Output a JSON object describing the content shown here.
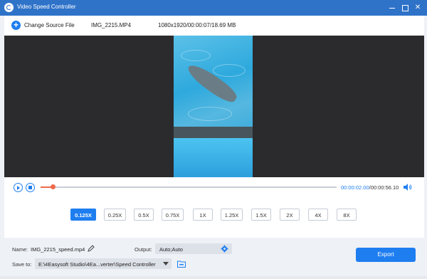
{
  "window": {
    "title": "Video Speed Controller"
  },
  "topbar": {
    "change_source_label": "Change Source File",
    "filename": "IMG_2215.MP4",
    "fileinfo": "1080x1920/00:00:07/18.69 MB"
  },
  "player": {
    "current_time": "00:00:02.00",
    "separator": "/",
    "total_time": "00:00:56.10",
    "progress": 0.04
  },
  "speeds": [
    {
      "label": "0.125X",
      "active": true
    },
    {
      "label": "0.25X",
      "active": false
    },
    {
      "label": "0.5X",
      "active": false
    },
    {
      "label": "0.75X",
      "active": false
    },
    {
      "label": "1X",
      "active": false
    },
    {
      "label": "1.25X",
      "active": false
    },
    {
      "label": "1.5X",
      "active": false
    },
    {
      "label": "2X",
      "active": false
    },
    {
      "label": "4X",
      "active": false
    },
    {
      "label": "8X",
      "active": false
    }
  ],
  "settings": {
    "name_label": "Name:",
    "name_value": "IMG_2215_speed.mp4",
    "output_label": "Output:",
    "output_value": "Auto;Auto",
    "save_label": "Save to:",
    "save_value": "E:\\4Easysoft Studio\\4Ea...verter\\Speed Controller",
    "export_label": "Export"
  },
  "colors": {
    "accent": "#1e7ef0",
    "titlebar": "#2f73c9",
    "progress": "#f06a4a"
  }
}
